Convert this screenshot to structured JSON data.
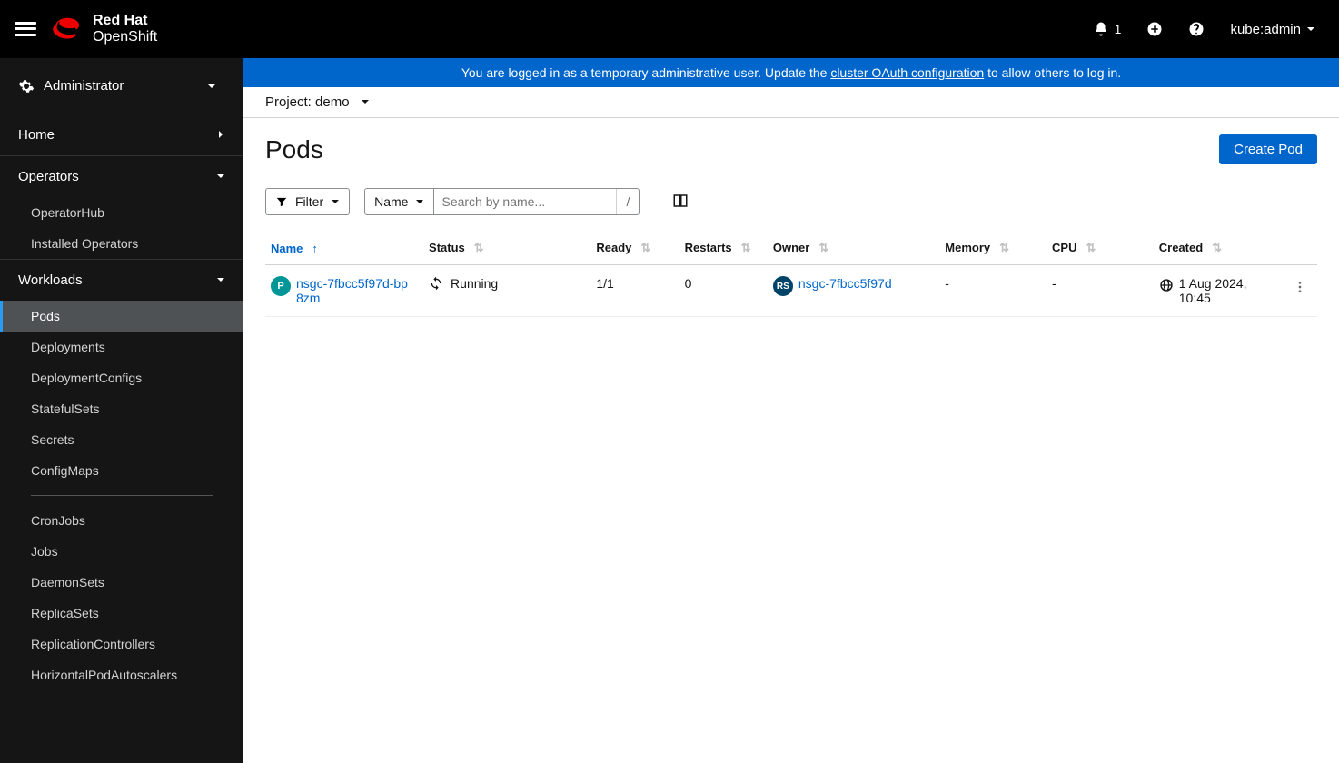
{
  "brand": {
    "line1": "Red Hat",
    "line2": "OpenShift"
  },
  "header": {
    "notif_count": "1",
    "user": "kube:admin"
  },
  "banner": {
    "prefix": "You are logged in as a temporary administrative user. Update the ",
    "link": "cluster OAuth configuration",
    "suffix": " to allow others to log in."
  },
  "sidebar": {
    "perspective": "Administrator",
    "home": "Home",
    "operators": {
      "label": "Operators",
      "items": [
        "OperatorHub",
        "Installed Operators"
      ]
    },
    "workloads": {
      "label": "Workloads",
      "items_a": [
        "Pods",
        "Deployments",
        "DeploymentConfigs",
        "StatefulSets",
        "Secrets",
        "ConfigMaps"
      ],
      "items_b": [
        "CronJobs",
        "Jobs",
        "DaemonSets",
        "ReplicaSets",
        "ReplicationControllers",
        "HorizontalPodAutoscalers"
      ]
    }
  },
  "project": {
    "label": "Project:",
    "value": "demo"
  },
  "page": {
    "title": "Pods",
    "create_btn": "Create Pod",
    "filter_btn": "Filter",
    "search_by": "Name",
    "search_placeholder": "Search by name...",
    "slash_hint": "/"
  },
  "table": {
    "cols": {
      "name": "Name",
      "status": "Status",
      "ready": "Ready",
      "restarts": "Restarts",
      "owner": "Owner",
      "memory": "Memory",
      "cpu": "CPU",
      "created": "Created"
    },
    "rows": [
      {
        "name": "nsgc-7fbcc5f97d-bp8zm",
        "status": "Running",
        "ready": "1/1",
        "restarts": "0",
        "owner": "nsgc-7fbcc5f97d",
        "memory": "-",
        "cpu": "-",
        "created": "1 Aug 2024, 10:45"
      }
    ]
  }
}
